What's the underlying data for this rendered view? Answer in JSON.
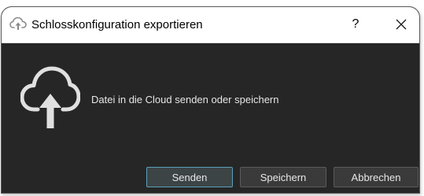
{
  "window": {
    "title": "Schlosskonfiguration exportieren",
    "title_icon": "cloud-upload-icon",
    "help_label": "?",
    "close_icon": "close-icon"
  },
  "content": {
    "icon": "cloud-upload-icon",
    "message": "Datei in die Cloud senden oder speichern"
  },
  "buttons": {
    "send": "Senden",
    "save": "Speichern",
    "cancel": "Abbrechen"
  },
  "colors": {
    "dialog_background": "#262626",
    "titlebar_background": "#ffffff",
    "default_button_border": "#5aa0b8"
  }
}
